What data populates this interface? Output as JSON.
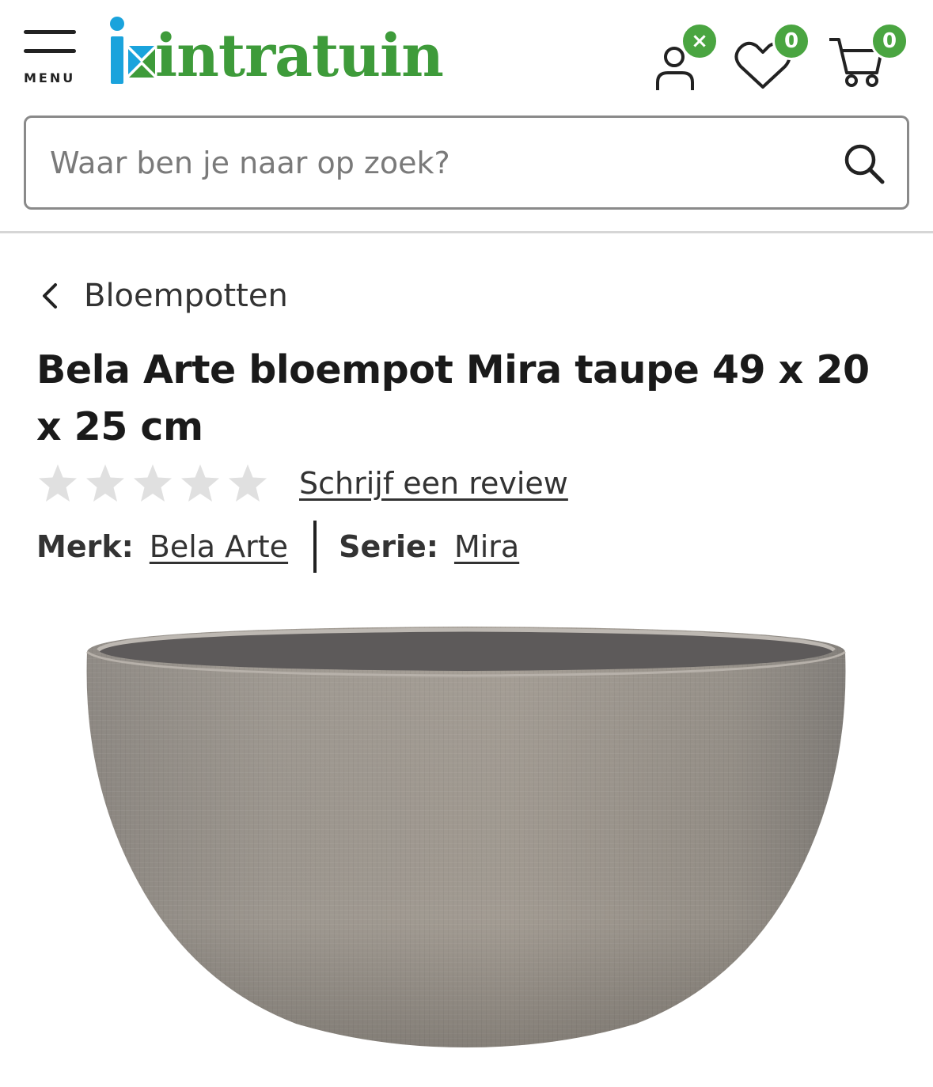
{
  "header": {
    "menu_label": "MENU",
    "logo_text": "intratuin",
    "account_badge": "×",
    "wishlist_count": "0",
    "cart_count": "0"
  },
  "search": {
    "placeholder": "Waar ben je naar op zoek?"
  },
  "breadcrumb": {
    "label": "Bloempotten"
  },
  "product": {
    "title": "Bela Arte bloempot Mira taupe 49 x 20 x 25 cm",
    "rating": 0,
    "rating_max": 5,
    "review_link": "Schrijf een review",
    "brand_key": "Merk:",
    "brand_value": "Bela Arte",
    "series_key": "Serie:",
    "series_value": "Mira"
  },
  "colors": {
    "brand_green": "#3e9b3a",
    "badge_green": "#4aa541",
    "logo_blue": "#1aa3dc",
    "star_empty": "#e0e0e0"
  },
  "icons": [
    "menu-icon",
    "account-icon",
    "heart-icon",
    "cart-icon",
    "search-icon",
    "chevron-left-icon",
    "star-icon"
  ]
}
